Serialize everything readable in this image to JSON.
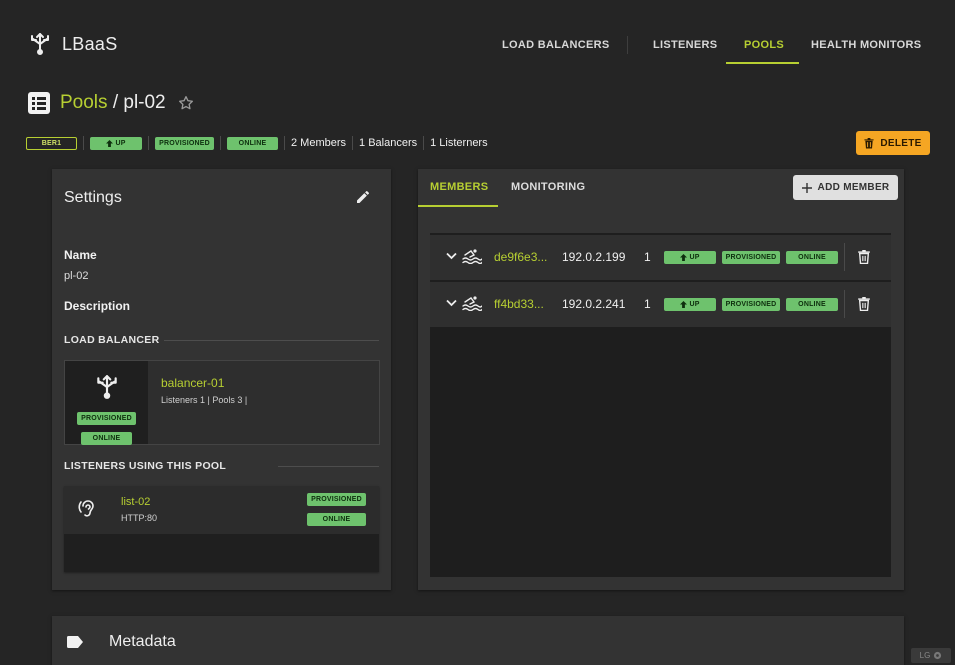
{
  "brand": {
    "name": "LBaaS"
  },
  "nav": {
    "items": [
      {
        "label": "LOAD BALANCERS"
      },
      {
        "label": "LISTENERS"
      },
      {
        "label": "POOLS",
        "active": true
      },
      {
        "label": "HEALTH MONITORS"
      }
    ]
  },
  "title": {
    "section": "Pools",
    "separator": "/",
    "name": "pl-02"
  },
  "badges": {
    "region": "BER1",
    "operating": "UP",
    "provisioning": "PROVISIONED",
    "status": "ONLINE",
    "members": "2 Members",
    "balancers": "1 Balancers",
    "listeners": "1 Listerners"
  },
  "actions": {
    "delete": "DELETE"
  },
  "settings": {
    "title": "Settings",
    "name_label": "Name",
    "name_value": "pl-02",
    "description_label": "Description",
    "lb_section": "LOAD BALANCER",
    "lb": {
      "name": "balancer-01",
      "meta": "Listeners 1 | Pools 3 |",
      "provisioning": "PROVISIONED",
      "status": "ONLINE"
    },
    "listeners_section": "LISTENERS USING THIS POOL",
    "listener": {
      "name": "list-02",
      "protocol": "HTTP:80",
      "provisioning": "PROVISIONED",
      "status": "ONLINE"
    }
  },
  "members_panel": {
    "tabs": [
      {
        "label": "MEMBERS",
        "active": true
      },
      {
        "label": "MONITORING"
      }
    ],
    "add_label": "ADD MEMBER",
    "rows": [
      {
        "id": "de9f6e3...",
        "ip": "192.0.2.199",
        "weight": "1",
        "operating": "UP",
        "provisioning": "PROVISIONED",
        "status": "ONLINE"
      },
      {
        "id": "ff4bd33...",
        "ip": "192.0.2.241",
        "weight": "1",
        "operating": "UP",
        "provisioning": "PROVISIONED",
        "status": "ONLINE"
      }
    ]
  },
  "metadata": {
    "title": "Metadata"
  },
  "footer_badge": {
    "label": "LG"
  },
  "colors": {
    "accent": "#b7cf32",
    "status_green": "#6ec26d",
    "warning": "#f5a623",
    "background": "#252525",
    "card": "#333333"
  }
}
